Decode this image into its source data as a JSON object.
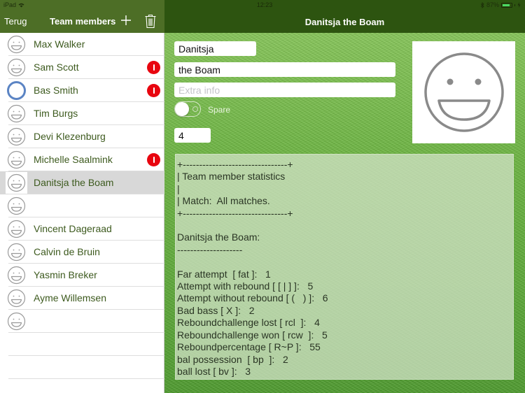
{
  "status_bar": {
    "device": "iPad",
    "time": "12:23",
    "battery": "87%",
    "battery_level": 0.87
  },
  "left_nav": {
    "back_label": "Terug",
    "title": "Team members",
    "add_icon": "plus-icon",
    "delete_icon": "trash-icon"
  },
  "right_nav": {
    "title": "Danitsja the Boam"
  },
  "members": [
    {
      "name": "Max Walker",
      "avatar": "smiley-icon",
      "alert": false,
      "selected": false
    },
    {
      "name": "Sam Scott",
      "avatar": "smiley-icon",
      "alert": true,
      "selected": false
    },
    {
      "name": "Bas Smith",
      "avatar": "ring-icon",
      "alert": true,
      "selected": false
    },
    {
      "name": "Tim Burgs",
      "avatar": "smiley-icon",
      "alert": false,
      "selected": false
    },
    {
      "name": "Devi Klezenburg",
      "avatar": "smiley-icon",
      "alert": false,
      "selected": false
    },
    {
      "name": "Michelle Saalmink",
      "avatar": "smiley-icon",
      "alert": true,
      "selected": false
    },
    {
      "name": "Danitsja the Boam",
      "avatar": "smiley-icon",
      "alert": false,
      "selected": true
    },
    {
      "name": "",
      "avatar": "smiley-icon",
      "alert": false,
      "selected": false
    },
    {
      "name": "Vincent Dageraad",
      "avatar": "smiley-icon",
      "alert": false,
      "selected": false
    },
    {
      "name": "Calvin de Bruin",
      "avatar": "smiley-icon",
      "alert": false,
      "selected": false
    },
    {
      "name": "Yasmin Breker",
      "avatar": "smiley-icon",
      "alert": false,
      "selected": false
    },
    {
      "name": "Ayme Willemsen",
      "avatar": "smiley-icon",
      "alert": false,
      "selected": false
    },
    {
      "name": "",
      "avatar": "smiley-icon",
      "alert": false,
      "selected": false
    },
    {
      "name": "",
      "avatar": null,
      "alert": false,
      "selected": false
    },
    {
      "name": "",
      "avatar": null,
      "alert": false,
      "selected": false
    }
  ],
  "detail": {
    "first_name": "Danitsja",
    "last_name": "the Boam",
    "extra_info_value": "",
    "extra_info_placeholder": "Extra info",
    "spare_label": "Spare",
    "spare_on": false,
    "number": "4",
    "photo_icon": "smiley-icon"
  },
  "stats_lines": [
    "+--------------------------------+",
    "| Team member statistics",
    "|",
    "| Match:  All matches.",
    "+--------------------------------+",
    "",
    "Danitsja the Boam:",
    "--------------------",
    "",
    "Far attempt  [ fat ]:   1",
    "Attempt with rebound [ [ | ] ]:   5",
    "Attempt without rebound [ (   ) ]:   6",
    "Bad bass [ X ]:   2",
    "Reboundchallenge lost [ rcl  ]:   4",
    "Reboundchallenge won [ rcw  ]:   5",
    "Reboundpercentage [ R~P ]:   55",
    "bal possession  [ bp  ]:   2",
    "ball lost [ bv ]:   3"
  ],
  "colors": {
    "nav_left": "#4d6e26",
    "nav_right": "#2d5410",
    "name_text": "#3d5a1e",
    "alert_badge": "#e8050f",
    "ring_avatar": "#5b84c4"
  }
}
